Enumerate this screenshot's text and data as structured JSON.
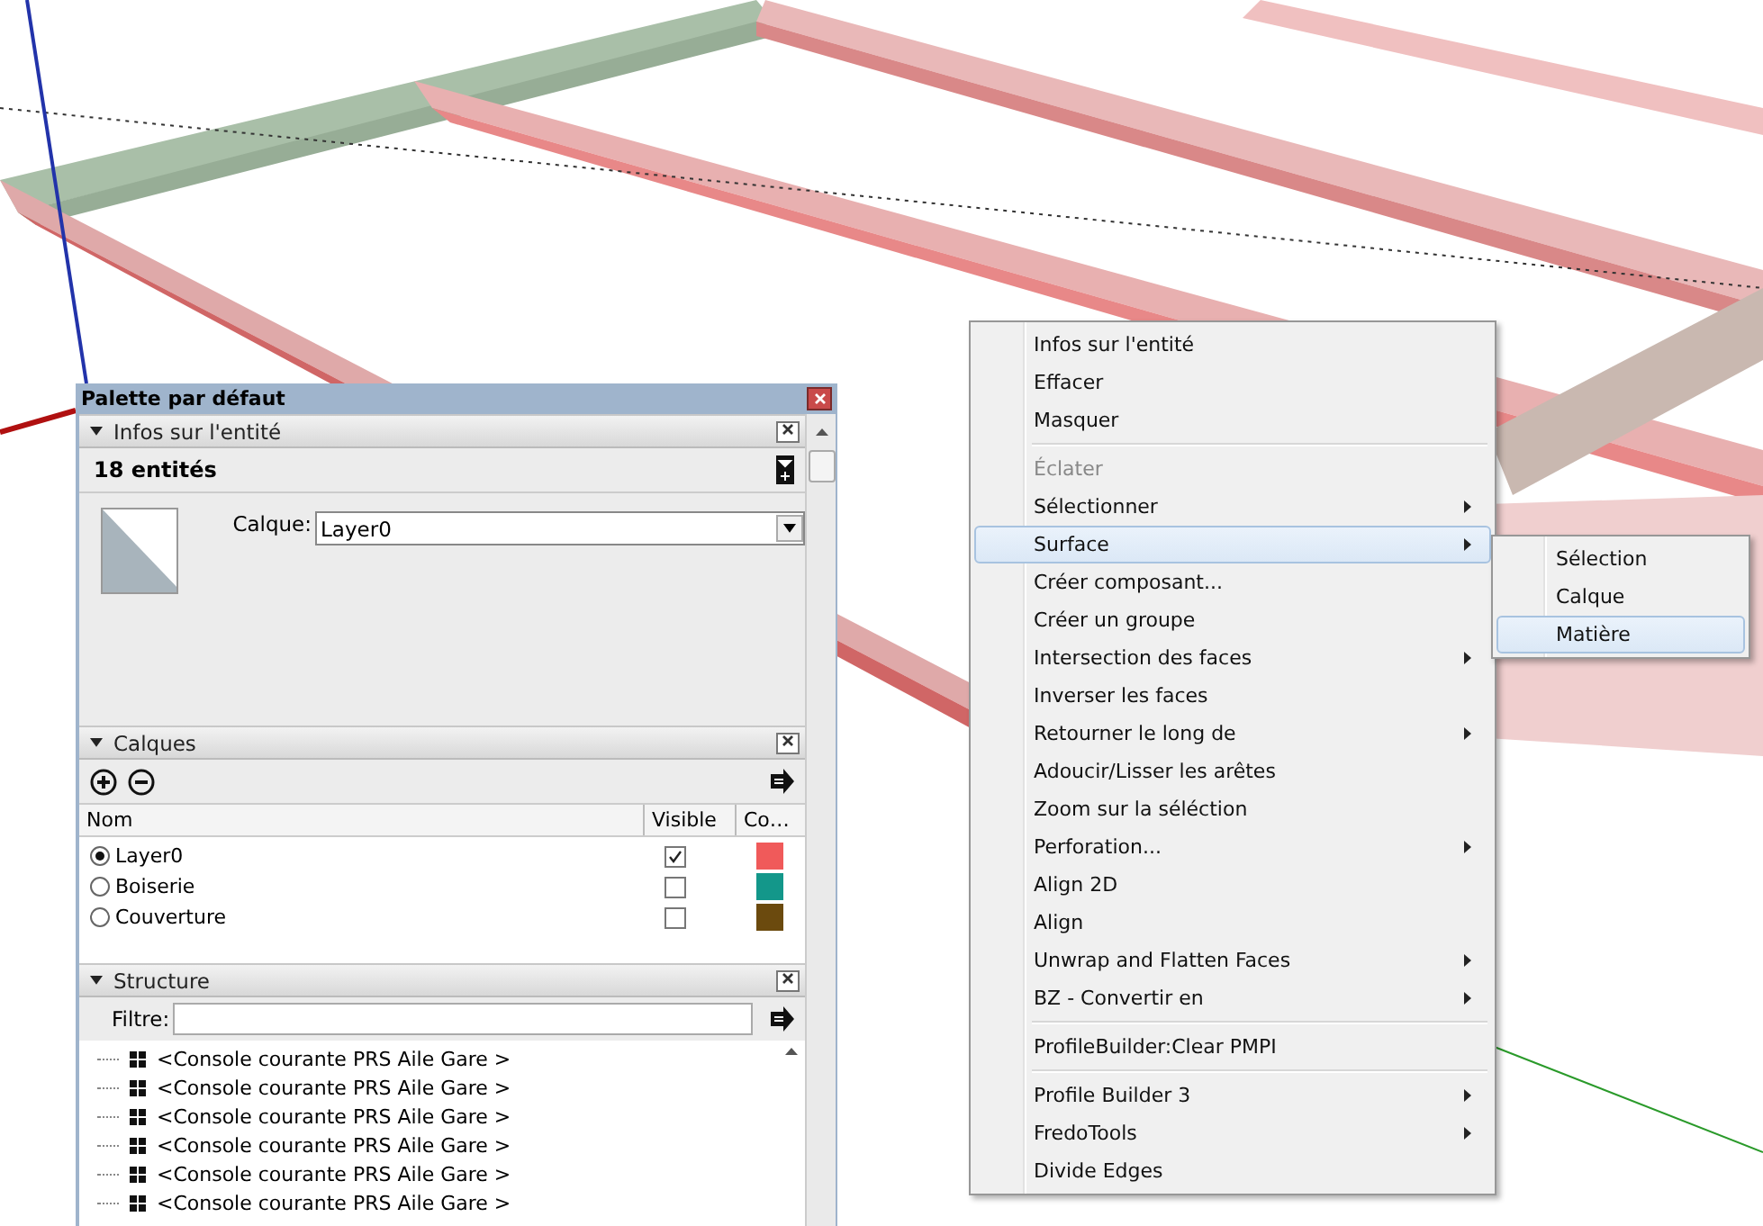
{
  "palette": {
    "title": "Palette par défaut",
    "entity_info": {
      "title": "Infos sur l'entité",
      "expanded": true,
      "count": "18 entités",
      "layer_label": "Calque:",
      "layer_value": "Layer0"
    },
    "layers": {
      "title": "Calques",
      "expanded": true,
      "columns": [
        "Nom",
        "Visible",
        "Co…"
      ],
      "rows": [
        {
          "name": "Layer0",
          "selected": true,
          "visible": true,
          "color": "#f05a5a"
        },
        {
          "name": "Boiserie",
          "selected": false,
          "visible": false,
          "color": "#13978a"
        },
        {
          "name": "Couverture",
          "selected": false,
          "visible": false,
          "color": "#6b4a0e"
        }
      ]
    },
    "outliner": {
      "title": "Structure",
      "expanded": true,
      "filter_label": "Filtre:",
      "items": [
        "<Console courante PRS Aile Gare >",
        "<Console courante PRS Aile Gare >",
        "<Console courante PRS Aile Gare >",
        "<Console courante PRS Aile Gare >",
        "<Console courante PRS Aile Gare >",
        "<Console courante PRS Aile Gare >"
      ]
    }
  },
  "context_menu": {
    "items": [
      {
        "kind": "item",
        "label": "Infos sur l'entité",
        "disabled": false,
        "submenu": false,
        "selected": false
      },
      {
        "kind": "item",
        "label": "Effacer",
        "disabled": false,
        "submenu": false,
        "selected": false
      },
      {
        "kind": "item",
        "label": "Masquer",
        "disabled": false,
        "submenu": false,
        "selected": false
      },
      {
        "kind": "separator"
      },
      {
        "kind": "item",
        "label": "Éclater",
        "disabled": true,
        "submenu": false,
        "selected": false
      },
      {
        "kind": "item",
        "label": "Sélectionner",
        "disabled": false,
        "submenu": true,
        "selected": false
      },
      {
        "kind": "item",
        "label": "Surface",
        "disabled": false,
        "submenu": true,
        "selected": true
      },
      {
        "kind": "item",
        "label": "Créer composant...",
        "disabled": false,
        "submenu": false,
        "selected": false
      },
      {
        "kind": "item",
        "label": "Créer un groupe",
        "disabled": false,
        "submenu": false,
        "selected": false
      },
      {
        "kind": "item",
        "label": "Intersection des faces",
        "disabled": false,
        "submenu": true,
        "selected": false
      },
      {
        "kind": "item",
        "label": "Inverser les faces",
        "disabled": false,
        "submenu": false,
        "selected": false
      },
      {
        "kind": "item",
        "label": "Retourner le long de",
        "disabled": false,
        "submenu": true,
        "selected": false
      },
      {
        "kind": "item",
        "label": "Adoucir/Lisser les arêtes",
        "disabled": false,
        "submenu": false,
        "selected": false
      },
      {
        "kind": "item",
        "label": "Zoom sur la séléction",
        "disabled": false,
        "submenu": false,
        "selected": false
      },
      {
        "kind": "item",
        "label": "Perforation...",
        "disabled": false,
        "submenu": true,
        "selected": false
      },
      {
        "kind": "item",
        "label": "Align 2D",
        "disabled": false,
        "submenu": false,
        "selected": false
      },
      {
        "kind": "item",
        "label": "Align",
        "disabled": false,
        "submenu": false,
        "selected": false
      },
      {
        "kind": "item",
        "label": "Unwrap and Flatten Faces",
        "disabled": false,
        "submenu": true,
        "selected": false
      },
      {
        "kind": "item",
        "label": "BZ - Convertir en",
        "disabled": false,
        "submenu": true,
        "selected": false
      },
      {
        "kind": "separator"
      },
      {
        "kind": "item",
        "label": "ProfileBuilder:Clear PMPI",
        "disabled": false,
        "submenu": false,
        "selected": false
      },
      {
        "kind": "separator"
      },
      {
        "kind": "item",
        "label": "Profile Builder 3",
        "disabled": false,
        "submenu": true,
        "selected": false
      },
      {
        "kind": "item",
        "label": "FredoTools",
        "disabled": false,
        "submenu": true,
        "selected": false
      },
      {
        "kind": "item",
        "label": "Divide Edges",
        "disabled": false,
        "submenu": false,
        "selected": false
      }
    ]
  },
  "submenu": {
    "items": [
      {
        "label": "Sélection",
        "selected": false
      },
      {
        "label": "Calque",
        "selected": false
      },
      {
        "label": "Matière",
        "selected": true
      }
    ]
  }
}
